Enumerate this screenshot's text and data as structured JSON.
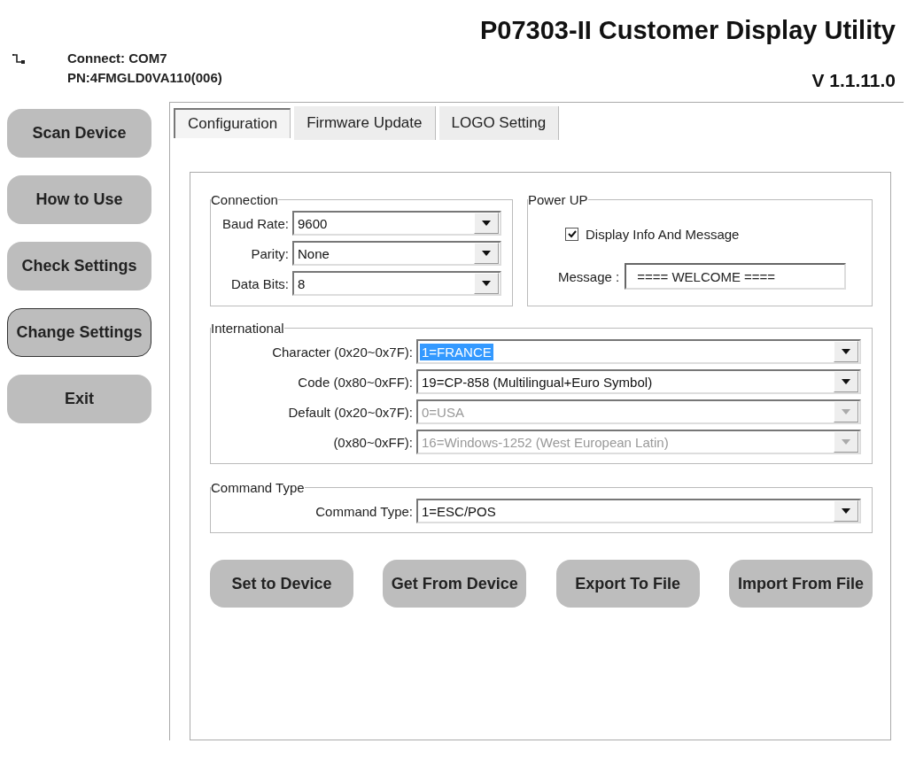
{
  "app_title": "P07303-II Customer Display Utility",
  "connection_status": "Connect: COM7",
  "part_number": "PN:4FMGLD0VA110(006)",
  "version": "V 1.1.11.0",
  "nav_buttons": [
    {
      "label": "Scan Device",
      "focused": false
    },
    {
      "label": "How to Use",
      "focused": false
    },
    {
      "label": "Check Settings",
      "focused": false
    },
    {
      "label": "Change Settings",
      "focused": true
    },
    {
      "label": "Exit",
      "focused": false
    }
  ],
  "tabs": [
    {
      "label": "Configuration",
      "selected": true
    },
    {
      "label": "Firmware Update",
      "selected": false
    },
    {
      "label": "LOGO Setting",
      "selected": false
    }
  ],
  "connection": {
    "title": "Connection",
    "fields": [
      {
        "label": "Baud Rate:",
        "value": "9600",
        "disabled": false,
        "highlighted": false
      },
      {
        "label": "Parity:",
        "value": "None",
        "disabled": false,
        "highlighted": false
      },
      {
        "label": "Data Bits:",
        "value": "8",
        "disabled": false,
        "highlighted": false
      }
    ]
  },
  "power_up": {
    "title": "Power UP",
    "checkbox": {
      "label": "Display Info And Message",
      "checked": true
    },
    "message_label": "Message :",
    "message_value": "==== WELCOME ===="
  },
  "international": {
    "title": "International",
    "fields": [
      {
        "label": "Character (0x20~0x7F):",
        "value": "1=FRANCE",
        "disabled": false,
        "highlighted": true
      },
      {
        "label": "Code (0x80~0xFF):",
        "value": "19=CP-858 (Multilingual+Euro Symbol)",
        "disabled": false,
        "highlighted": false
      },
      {
        "label": "Default (0x20~0x7F):",
        "value": "0=USA",
        "disabled": true,
        "highlighted": false
      },
      {
        "label": "(0x80~0xFF):",
        "value": "16=Windows-1252 (West European Latin)",
        "disabled": true,
        "highlighted": false
      }
    ]
  },
  "command_type": {
    "title": "Command Type",
    "fields": [
      {
        "label": "Command Type:",
        "value": "1=ESC/POS",
        "disabled": false,
        "highlighted": false
      }
    ]
  },
  "action_buttons": [
    "Set to Device",
    "Get From Device",
    "Export To File",
    "Import From File"
  ]
}
